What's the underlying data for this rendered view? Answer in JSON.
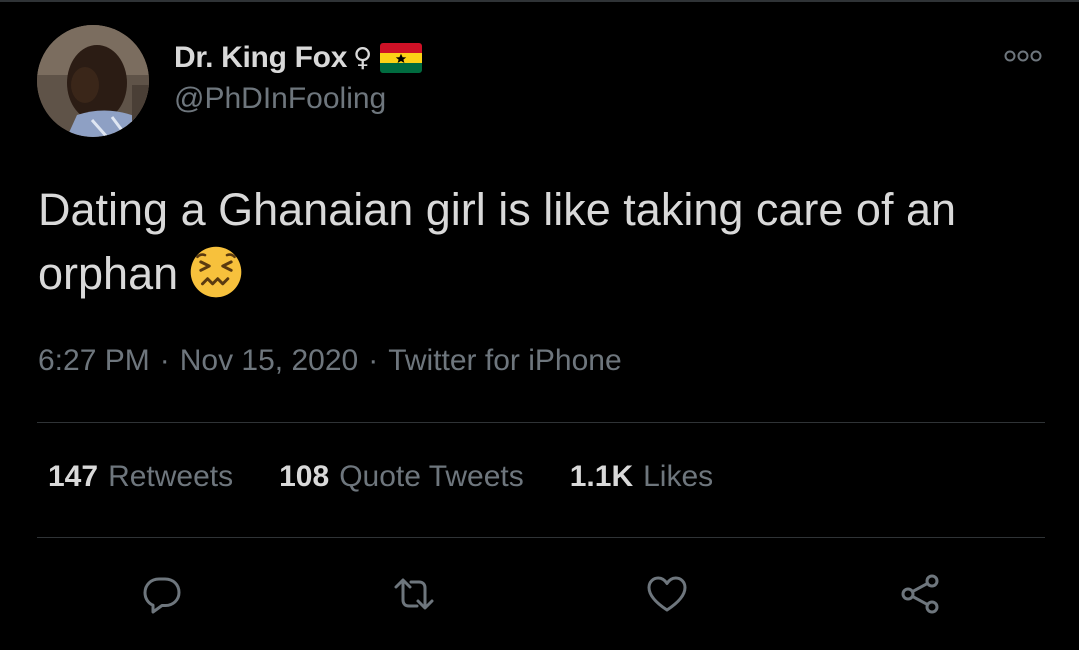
{
  "tweet": {
    "author": {
      "display_name": "Dr. King Fox",
      "badge_symbol": "♀",
      "flag": "ghana-flag",
      "username": "@PhDInFooling"
    },
    "text": "Dating a Ghanaian girl is like taking care of an orphan",
    "emoji": "confounded-face-emoji",
    "time": "6:27 PM",
    "date": "Nov 15, 2020",
    "source": "Twitter for iPhone",
    "separator": "·",
    "stats": [
      {
        "count": "147",
        "label": "Retweets"
      },
      {
        "count": "108",
        "label": "Quote Tweets"
      },
      {
        "count": "1.1K",
        "label": "Likes"
      }
    ],
    "actions": [
      "reply-icon",
      "retweet-icon",
      "like-icon",
      "share-icon"
    ]
  },
  "colors": {
    "background": "#000000",
    "primary_text": "#d9d9d9",
    "secondary_text": "#6e767d",
    "divider": "#2f3336"
  }
}
